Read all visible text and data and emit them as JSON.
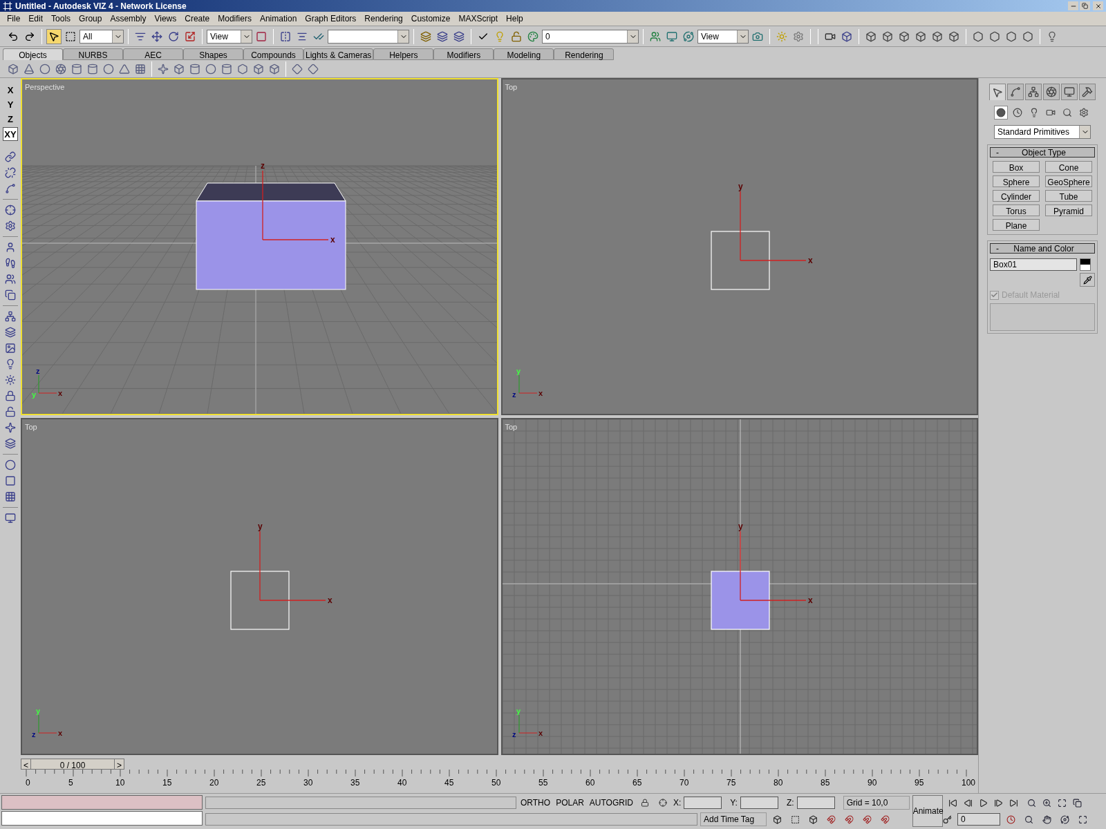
{
  "window": {
    "title": "Untitled - Autodesk VIZ 4 - Network License"
  },
  "menu": [
    "File",
    "Edit",
    "Tools",
    "Group",
    "Assembly",
    "Views",
    "Create",
    "Modifiers",
    "Animation",
    "Graph Editors",
    "Rendering",
    "Customize",
    "MAXScript",
    "Help"
  ],
  "toolbar": {
    "select_object_on": true,
    "selection_filter": "All",
    "reference_coord": "View",
    "layer": "0",
    "render_view": "View"
  },
  "tabs": [
    {
      "label": "Objects",
      "selected": true
    },
    {
      "label": "NURBS",
      "selected": false
    },
    {
      "label": "AEC",
      "selected": false
    },
    {
      "label": "Shapes",
      "selected": false
    },
    {
      "label": "Compounds",
      "selected": false
    },
    {
      "label": "Lights & Cameras",
      "selected": false
    },
    {
      "label": "Helpers",
      "selected": false
    },
    {
      "label": "Modifiers",
      "selected": false
    },
    {
      "label": "Modeling",
      "selected": false
    },
    {
      "label": "Rendering",
      "selected": false
    }
  ],
  "axis_constraints": [
    {
      "label": "X",
      "selected": false
    },
    {
      "label": "Y",
      "selected": false
    },
    {
      "label": "Z",
      "selected": false
    },
    {
      "label": "XY",
      "selected": true
    }
  ],
  "viewports": [
    {
      "label": "Perspective",
      "kind": "perspective",
      "active": true,
      "grid": true,
      "shaded": true,
      "gizmo_labels": [
        "x",
        "z"
      ],
      "tripod_labels": [
        "z",
        "y",
        "x"
      ]
    },
    {
      "label": "Top",
      "kind": "top",
      "active": false,
      "grid": false,
      "shaded": false,
      "gizmo_labels": [
        "x",
        "y"
      ],
      "tripod_labels": [
        "y",
        "z",
        "x"
      ]
    },
    {
      "label": "Top",
      "kind": "top",
      "active": false,
      "grid": false,
      "shaded": false,
      "gizmo_labels": [
        "x",
        "y"
      ],
      "tripod_labels": [
        "y",
        "z",
        "x"
      ]
    },
    {
      "label": "Top",
      "kind": "top",
      "active": false,
      "grid": true,
      "shaded": true,
      "gizmo_labels": [
        "x",
        "y"
      ],
      "tripod_labels": [
        "y",
        "z",
        "x"
      ]
    }
  ],
  "command_panel": {
    "create_tab_selected": true,
    "geometry_selected": true,
    "category": "Standard Primitives",
    "object_type": {
      "title": "Object Type",
      "collapse": "-",
      "buttons": [
        "Box",
        "Cone",
        "Sphere",
        "GeoSphere",
        "Cylinder",
        "Tube",
        "Torus",
        "Pyramid",
        "Plane"
      ]
    },
    "name_and_color": {
      "title": "Name and Color",
      "collapse": "-",
      "name": "Box01",
      "default_material": {
        "label": "Default Material",
        "checked": true,
        "disabled": true
      }
    }
  },
  "time_slider": {
    "label": "0 / 100",
    "prev": "<",
    "next": ">",
    "level": 0
  },
  "ruler_labels": [
    "0",
    "5",
    "10",
    "15",
    "20",
    "25",
    "30",
    "35",
    "40",
    "45",
    "50",
    "55",
    "60",
    "65",
    "70",
    "75",
    "80",
    "85",
    "90",
    "95",
    "100"
  ],
  "status": {
    "toggles": [
      "ORTHO",
      "POLAR",
      "AUTOGRID"
    ],
    "x_label": "X:",
    "y_label": "Y:",
    "z_label": "Z:",
    "grid": "Grid = 10,0",
    "time_tag": "Add Time Tag",
    "animate": "Animate",
    "frame": "0"
  }
}
